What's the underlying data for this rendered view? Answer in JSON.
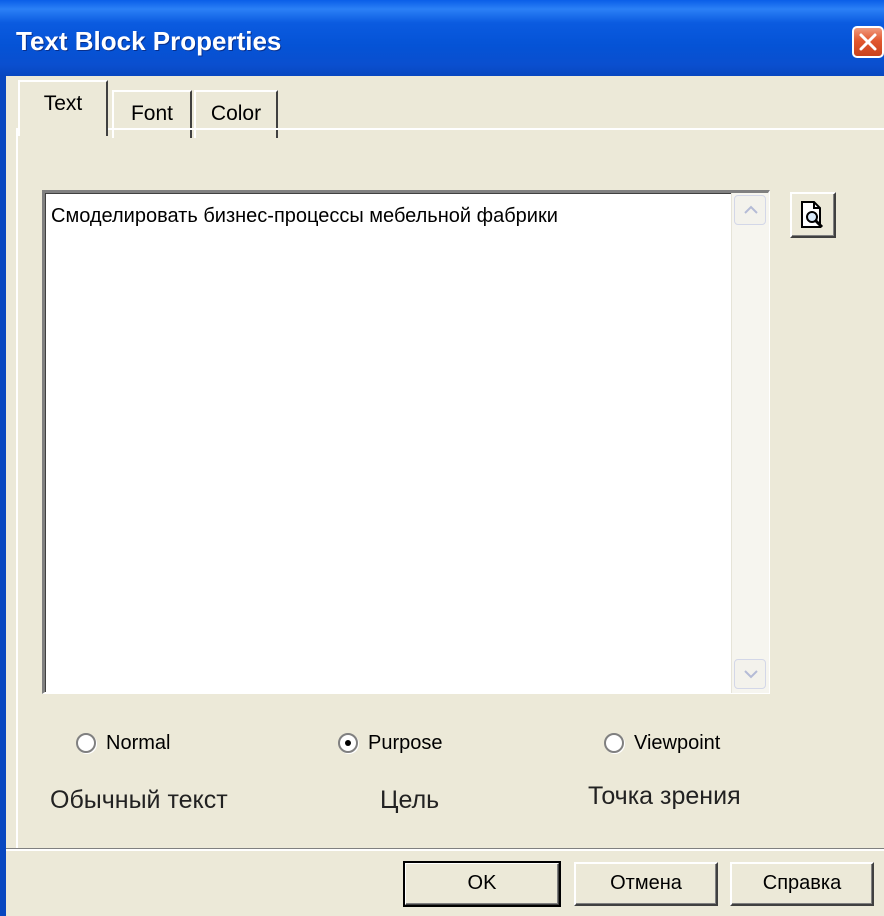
{
  "window": {
    "title": "Text Block Properties"
  },
  "tabs": [
    {
      "label": "Text",
      "active": true
    },
    {
      "label": "Font",
      "active": false
    },
    {
      "label": "Color",
      "active": false
    }
  ],
  "text_area": {
    "value": "Смоделировать бизнес-процессы мебельной фабрики"
  },
  "radios": [
    {
      "label": "Normal",
      "checked": false,
      "caption": "Обычный текст"
    },
    {
      "label": "Purpose",
      "checked": true,
      "caption": "Цель"
    },
    {
      "label": "Viewpoint",
      "checked": false,
      "caption": "Точка зрения"
    }
  ],
  "buttons": {
    "ok": "OK",
    "cancel": "Отмена",
    "help": "Справка"
  },
  "icons": {
    "close": "close-icon",
    "preview": "document-preview-icon"
  },
  "colors": {
    "titlebar": "#0553d6",
    "close": "#e2582f",
    "dialog": "#ece9d8"
  }
}
